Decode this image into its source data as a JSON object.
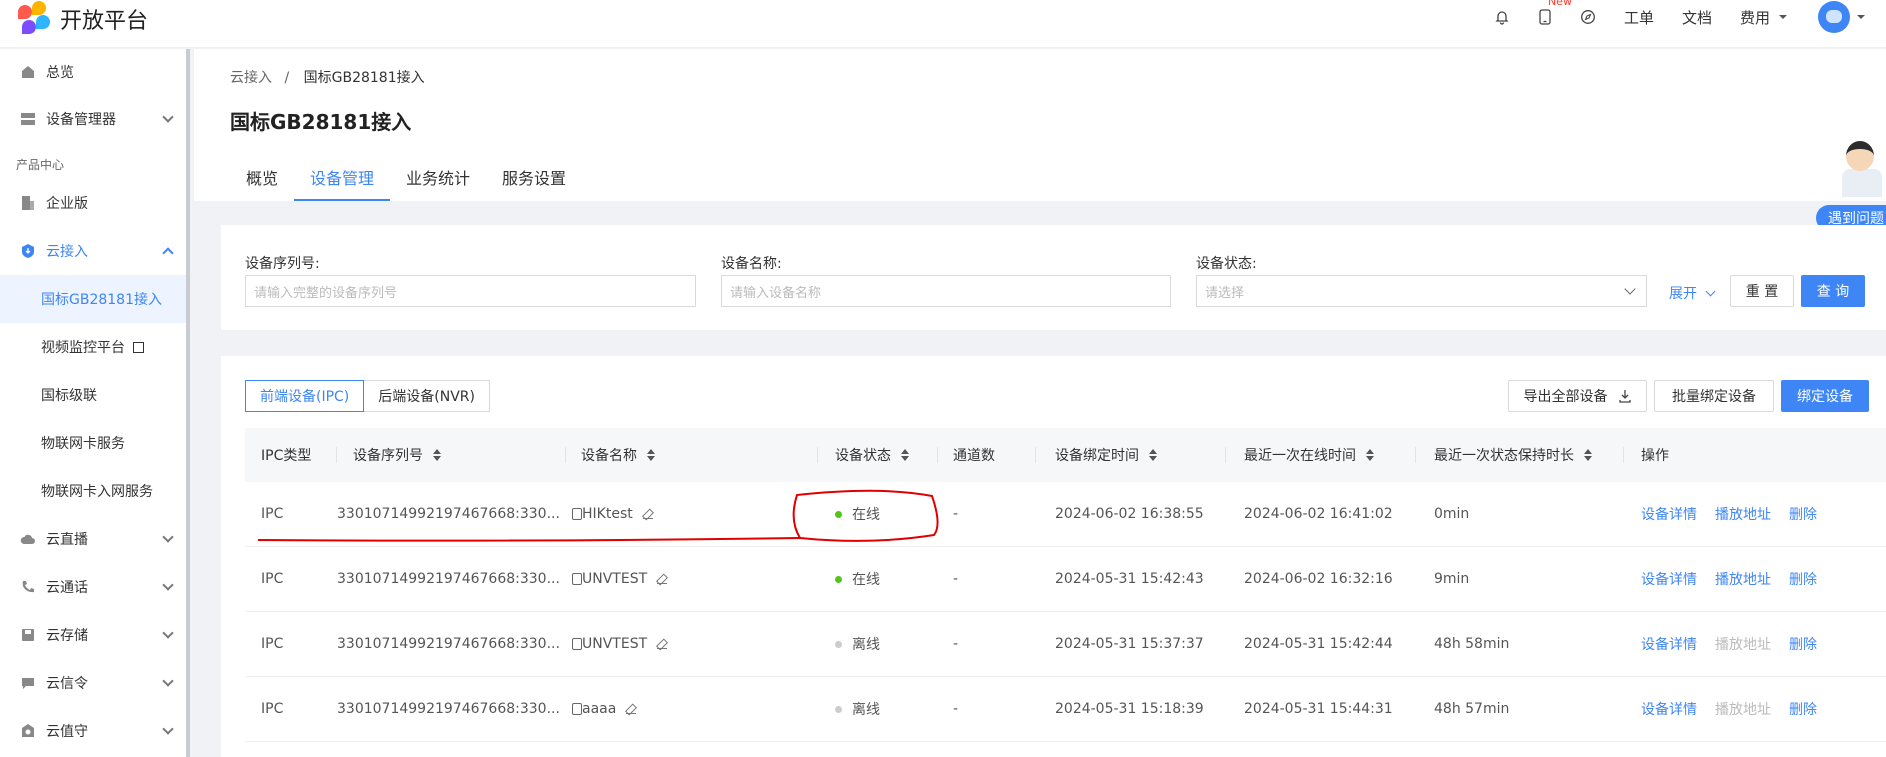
{
  "header": {
    "logo_text": "开放平台",
    "new_tag": "New",
    "workorder": "工单",
    "docs": "文档",
    "fees": "费用"
  },
  "sidebar": {
    "overview": "总览",
    "device_mgmt": "设备管理器",
    "group_label": "产品中心",
    "enterprise": "企业版",
    "cloud_access": "云接入",
    "sub_items": [
      "国标GB28181接入",
      "视频监控平台",
      "国标级联",
      "物联网卡服务",
      "物联网卡入网服务"
    ],
    "cloud_live": "云直播",
    "cloud_call": "云通话",
    "cloud_storage": "云存储",
    "cloud_signal": "云信令",
    "cloud_guard": "云值守"
  },
  "page": {
    "breadcrumb_root": "云接入",
    "breadcrumb_sep": "/",
    "breadcrumb_current": "国标GB28181接入",
    "title": "国标GB28181接入",
    "tabs": [
      "概览",
      "设备管理",
      "业务统计",
      "服务设置"
    ],
    "help_label": "遇到问题"
  },
  "filter": {
    "serial_label": "设备序列号:",
    "serial_placeholder": "请输入完整的设备序列号",
    "name_label": "设备名称:",
    "name_placeholder": "请输入设备名称",
    "status_label": "设备状态:",
    "status_placeholder": "请选择",
    "expand": "展开",
    "reset": "重 置",
    "query": "查 询"
  },
  "toolbar": {
    "seg_ipc": "前端设备(IPC)",
    "seg_nvr": "后端设备(NVR)",
    "export": "导出全部设备",
    "batch_bind": "批量绑定设备",
    "bind": "绑定设备"
  },
  "table": {
    "columns": [
      "IPC类型",
      "设备序列号",
      "设备名称",
      "设备状态",
      "通道数",
      "设备绑定时间",
      "最近一次在线时间",
      "最近一次状态保持时长",
      "操作"
    ],
    "actions": {
      "detail": "设备详情",
      "play": "播放地址",
      "delete": "删除"
    },
    "rows": [
      {
        "type": "IPC",
        "serial": "33010714992197467668:330...",
        "name": "HIKtest",
        "status": "在线",
        "channels": "-",
        "bind_time": "2024-06-02 16:38:55",
        "last_online": "2024-06-02 16:41:02",
        "duration": "0min",
        "play_enabled": true
      },
      {
        "type": "IPC",
        "serial": "33010714992197467668:330...",
        "name": "UNVTEST",
        "status": "在线",
        "channels": "-",
        "bind_time": "2024-05-31 15:42:43",
        "last_online": "2024-06-02 16:32:16",
        "duration": "9min",
        "play_enabled": true
      },
      {
        "type": "IPC",
        "serial": "33010714992197467668:330...",
        "name": "UNVTEST",
        "status": "离线",
        "channels": "-",
        "bind_time": "2024-05-31 15:37:37",
        "last_online": "2024-05-31 15:42:44",
        "duration": "48h 58min",
        "play_enabled": false
      },
      {
        "type": "IPC",
        "serial": "33010714992197467668:330...",
        "name": "aaaa",
        "status": "离线",
        "channels": "-",
        "bind_time": "2024-05-31 15:18:39",
        "last_online": "2024-05-31 15:44:31",
        "duration": "48h 57min",
        "play_enabled": false
      }
    ]
  },
  "colors": {
    "accent": "#3e86f5",
    "online": "#52c41a",
    "offline": "#cccccc",
    "annotation": "#e00000"
  }
}
